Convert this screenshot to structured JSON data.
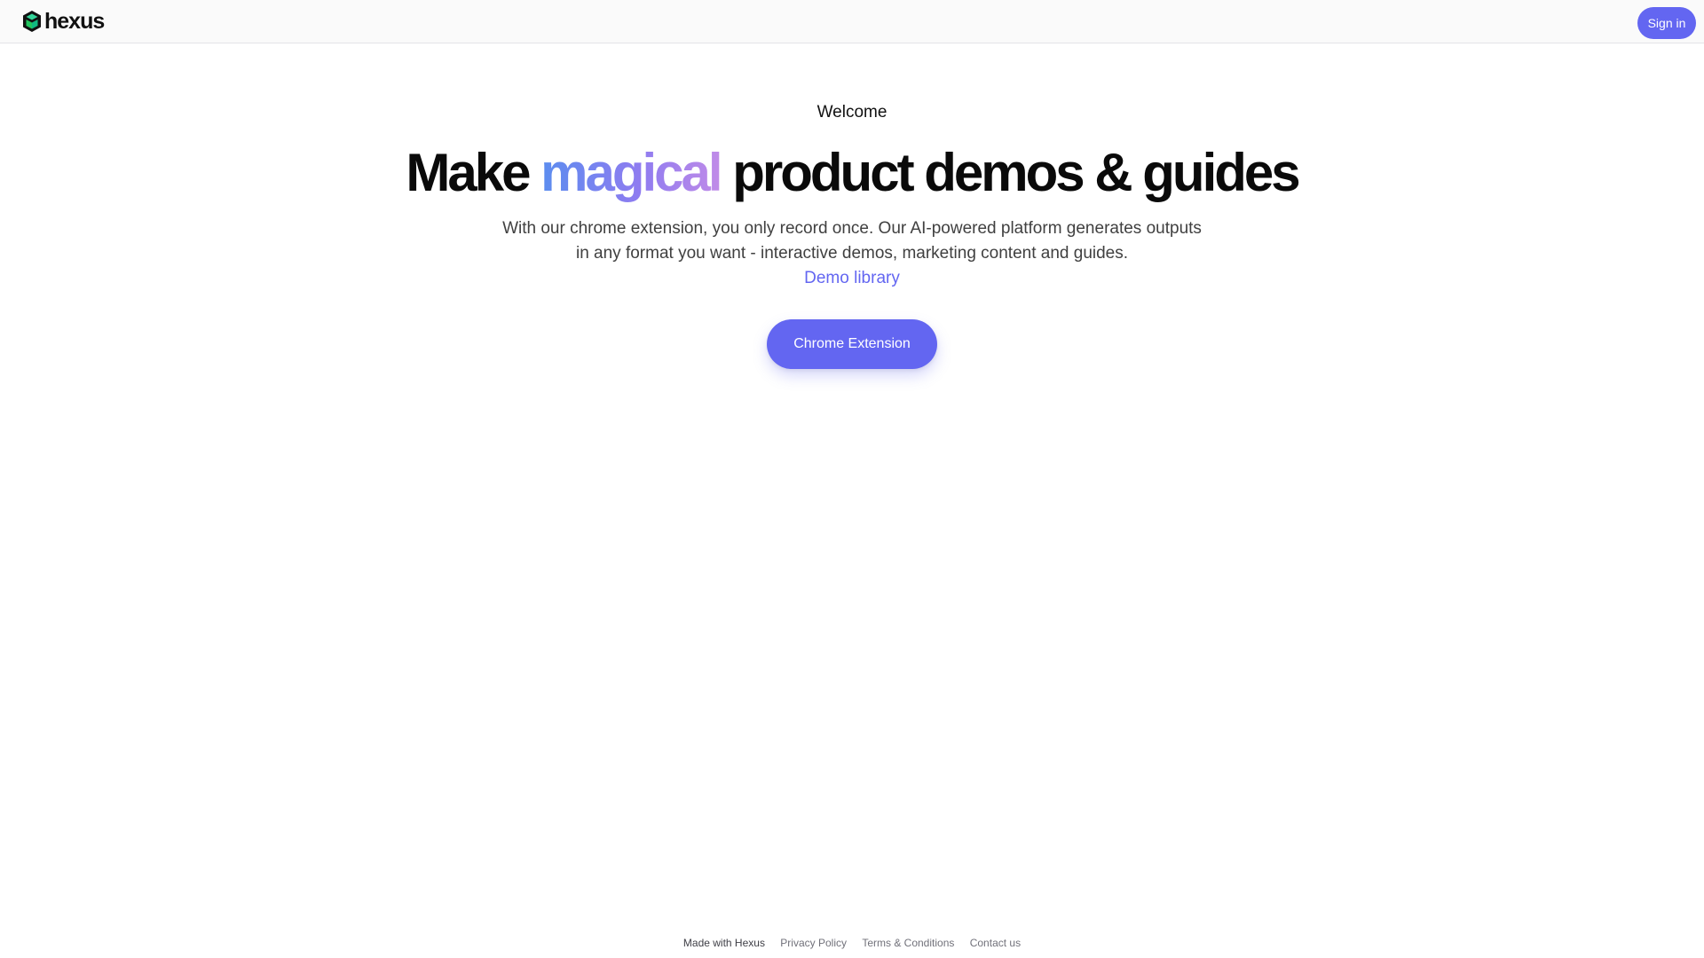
{
  "header": {
    "logo_text": "hexus",
    "signin_label": "Sign in"
  },
  "hero": {
    "welcome": "Welcome",
    "headline_before": "Make ",
    "headline_accent": "magical",
    "headline_after": " product demos & guides",
    "subtext": "With our chrome extension, you only record once. Our AI-powered platform generates outputs in any format you want - interactive demos, marketing content and guides.",
    "demo_link": "Demo library",
    "cta_label": "Chrome Extension"
  },
  "footer": {
    "made_with": "Made with Hexus",
    "links": [
      "Privacy Policy",
      "Terms & Conditions",
      "Contact us"
    ]
  },
  "colors": {
    "accent": "#6366f1",
    "gradient_start": "#5b8def",
    "gradient_end": "#c08be8",
    "logo_green": "#22c55e"
  }
}
